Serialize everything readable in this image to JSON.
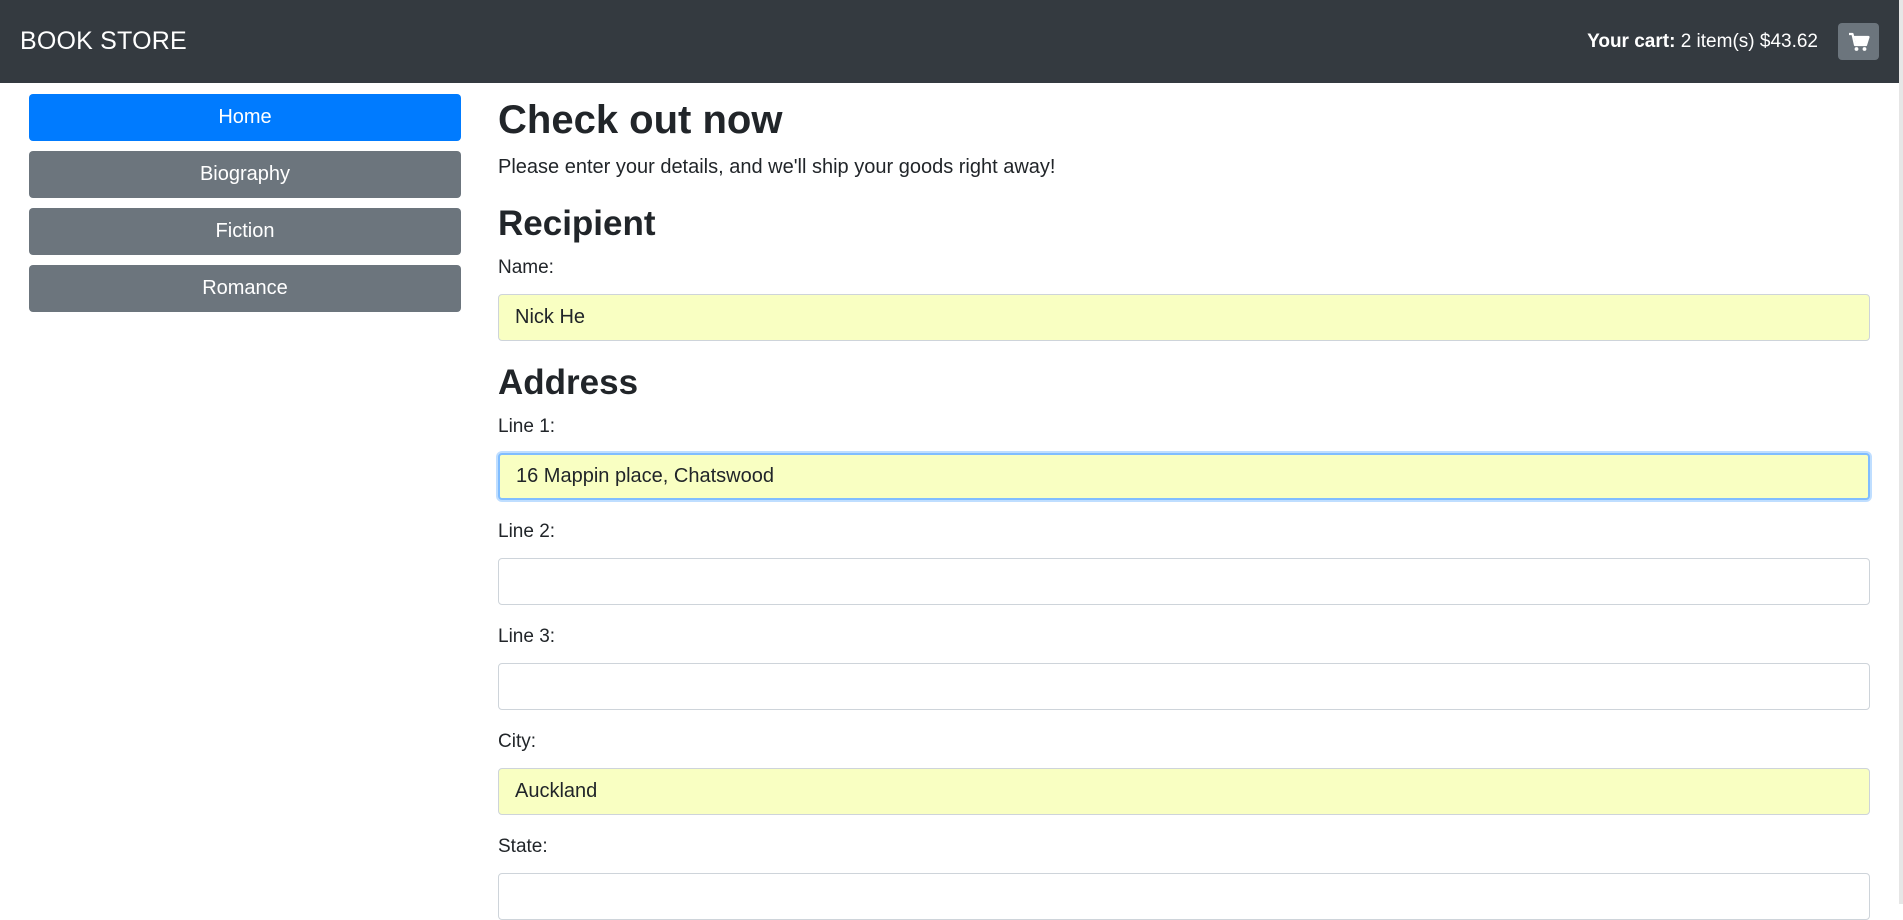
{
  "navbar": {
    "brand": "BOOK STORE",
    "cart_label": "Your cart:",
    "cart_summary": "2 item(s) $43.62",
    "cart_icon": "shopping-cart-icon"
  },
  "sidebar": {
    "items": [
      {
        "label": "Home",
        "active": true
      },
      {
        "label": "Biography",
        "active": false
      },
      {
        "label": "Fiction",
        "active": false
      },
      {
        "label": "Romance",
        "active": false
      }
    ]
  },
  "checkout": {
    "title": "Check out now",
    "intro": "Please enter your details, and we'll ship your goods right away!",
    "recipient_heading": "Recipient",
    "name_label": "Name:",
    "name_value": "Nick He",
    "address_heading": "Address",
    "line1_label": "Line 1:",
    "line1_value": "16 Mappin place, Chatswood",
    "line2_label": "Line 2:",
    "line2_value": "",
    "line3_label": "Line 3:",
    "line3_value": "",
    "city_label": "City:",
    "city_value": "Auckland",
    "state_label": "State:",
    "state_value": ""
  },
  "colors": {
    "navbar_bg": "#343a40",
    "primary": "#007bff",
    "secondary": "#6c757d",
    "autofill_bg": "#f9ffc2"
  }
}
